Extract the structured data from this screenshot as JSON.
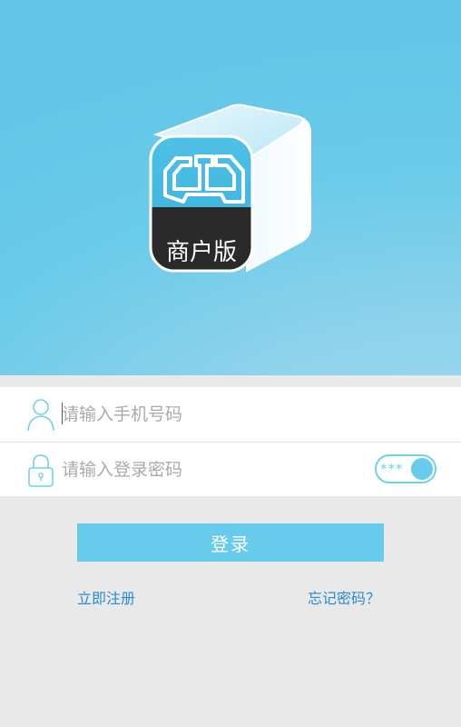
{
  "logo": {
    "badge_text": "商户版"
  },
  "login_form": {
    "phone_placeholder": "请输入手机号码",
    "password_placeholder": "请输入登录密码",
    "password_toggle_stars": "***"
  },
  "actions": {
    "login_label": "登录",
    "register_label": "立即注册",
    "forgot_label": "忘记密码？"
  },
  "colors": {
    "accent": "#67ccec",
    "link": "#2a8ad4",
    "background": "#e9e9e9"
  }
}
